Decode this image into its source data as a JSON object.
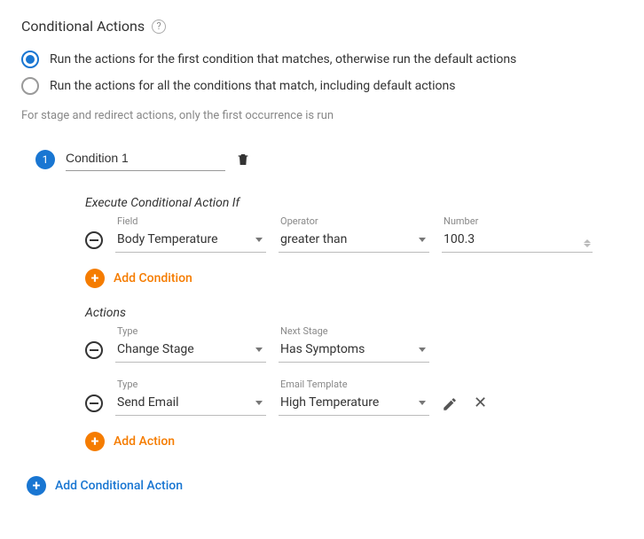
{
  "header": {
    "title": "Conditional Actions"
  },
  "mode_options": {
    "first_match": "Run the actions for the first condition that matches, otherwise run the default actions",
    "all_match": "Run the actions for all the conditions that match, including default actions",
    "selected": "first_match"
  },
  "hint": "For stage and redirect actions, only the first occurrence is run",
  "condition": {
    "number": "1",
    "name": "Condition 1",
    "exec_title": "Execute Conditional Action If",
    "rule": {
      "field_label": "Field",
      "field_value": "Body Temperature",
      "operator_label": "Operator",
      "operator_value": "greater than",
      "number_label": "Number",
      "number_value": "100.3"
    },
    "add_condition_label": "Add Condition",
    "actions_title": "Actions",
    "actions": [
      {
        "type_label": "Type",
        "type_value": "Change Stage",
        "param_label": "Next Stage",
        "param_value": "Has Symptoms",
        "show_edit_icons": false
      },
      {
        "type_label": "Type",
        "type_value": "Send Email",
        "param_label": "Email Template",
        "param_value": "High Temperature",
        "show_edit_icons": true
      }
    ],
    "add_action_label": "Add Action"
  },
  "add_conditional_label": "Add Conditional Action"
}
